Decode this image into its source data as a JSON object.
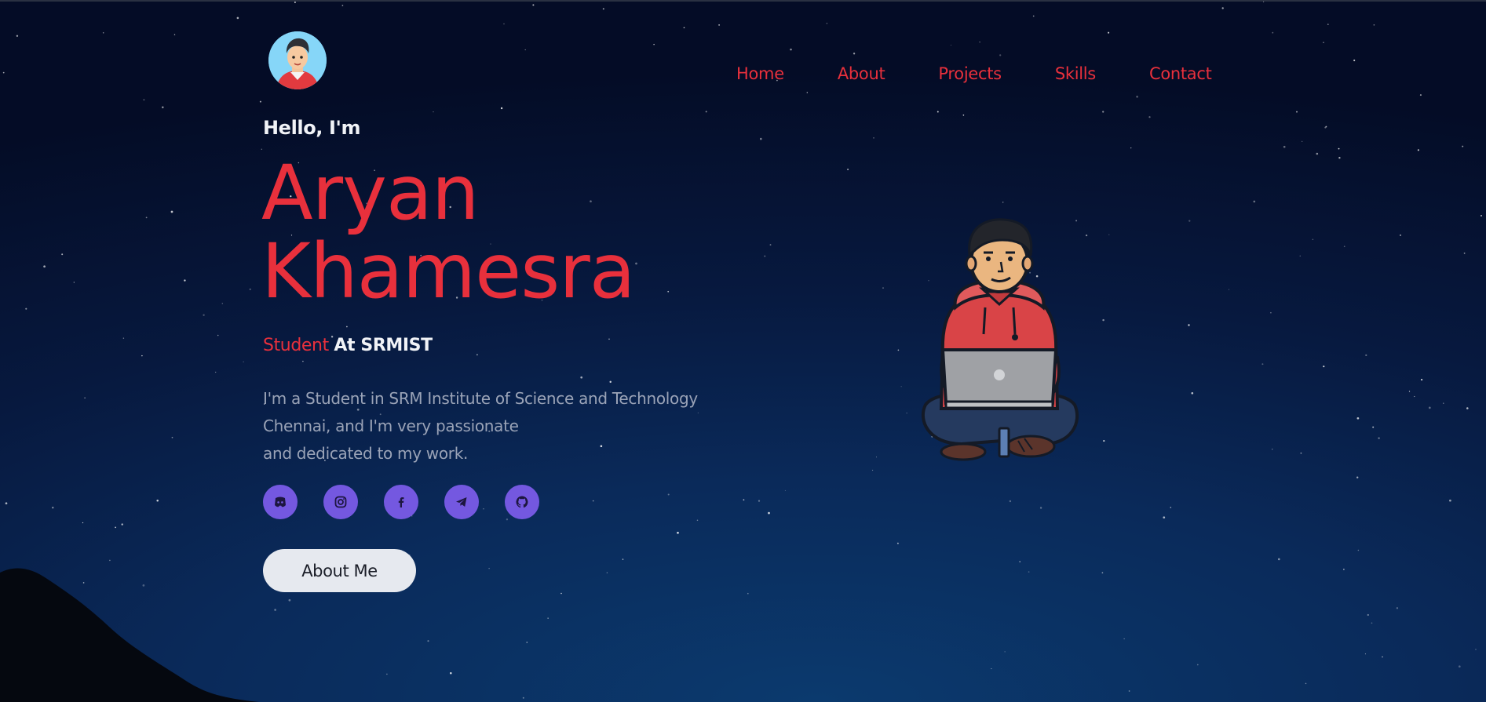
{
  "nav": {
    "items": [
      "Home",
      "About",
      "Projects",
      "Skills",
      "Contact"
    ],
    "color": "#e8303c"
  },
  "hero": {
    "greeting": "Hello, I'm",
    "name_line1": "Aryan",
    "name_line2": "Khamesra",
    "role_highlight": "Student",
    "role_rest": "At SRMIST",
    "description_lines": [
      "I'm a Student in SRM Institute of Science and Technology",
      "Chennai, and I'm very passionate",
      "and dedicated to my work."
    ],
    "about_button": "About Me"
  },
  "socials": [
    {
      "icon": "discord-icon"
    },
    {
      "icon": "instagram-icon"
    },
    {
      "icon": "facebook-icon"
    },
    {
      "icon": "telegram-icon"
    },
    {
      "icon": "github-icon"
    }
  ],
  "colors": {
    "accent": "#e8303c",
    "social_bg": "#7458e0",
    "button_bg": "#e6e9ef",
    "text_light": "#f1f3f7",
    "text_muted": "#9aa3b7"
  }
}
